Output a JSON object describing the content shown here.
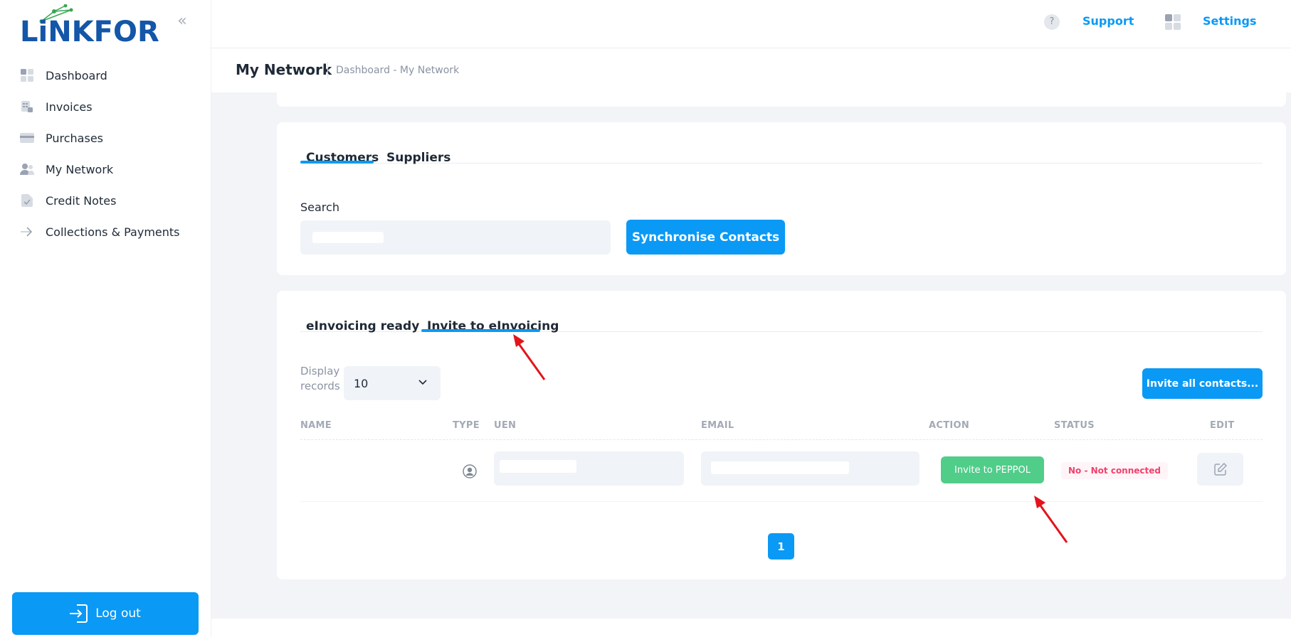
{
  "brand": {
    "logo_text": "LiNKFOR",
    "accent": "#0a99f5",
    "logo_color": "#1456a8"
  },
  "sidebar": {
    "collapse_icon": "chevrons-left-icon",
    "items": [
      {
        "label": "Dashboard",
        "icon": "dashboard-icon"
      },
      {
        "label": "Invoices",
        "icon": "invoice-icon"
      },
      {
        "label": "Purchases",
        "icon": "card-icon"
      },
      {
        "label": "My Network",
        "icon": "network-icon"
      },
      {
        "label": "Credit Notes",
        "icon": "document-icon"
      },
      {
        "label": "Collections & Payments",
        "icon": "arrow-right-icon"
      }
    ],
    "logout_label": "Log out"
  },
  "header": {
    "support_label": "Support",
    "settings_label": "Settings"
  },
  "page": {
    "title": "My Network",
    "breadcrumb": "Dashboard - My Network"
  },
  "contacts_card": {
    "tabs": [
      "Customers",
      "Suppliers"
    ],
    "active_tab": "Customers",
    "search_label": "Search",
    "search_value": "",
    "sync_button": "Synchronise Contacts"
  },
  "einvoice_card": {
    "tabs": [
      "eInvoicing ready",
      "Invite to eInvoicing"
    ],
    "active_tab": "Invite to eInvoicing",
    "display_label": "Display records",
    "display_label_line1": "Display",
    "display_label_line2": "records",
    "records_value": "10",
    "invite_all_button": "Invite all contacts...",
    "columns": [
      "NAME",
      "TYPE",
      "UEN",
      "EMAIL",
      "ACTION",
      "STATUS",
      "EDIT"
    ],
    "rows": [
      {
        "name": "",
        "type_icon": "user-circle-icon",
        "uen": "",
        "email": "",
        "action": "Invite to PEPPOL",
        "status": "No - Not connected",
        "edit_icon": "edit-icon"
      }
    ],
    "pagination": {
      "current": "1"
    },
    "status_color": "#f1416c",
    "action_color": "#50cd89"
  }
}
